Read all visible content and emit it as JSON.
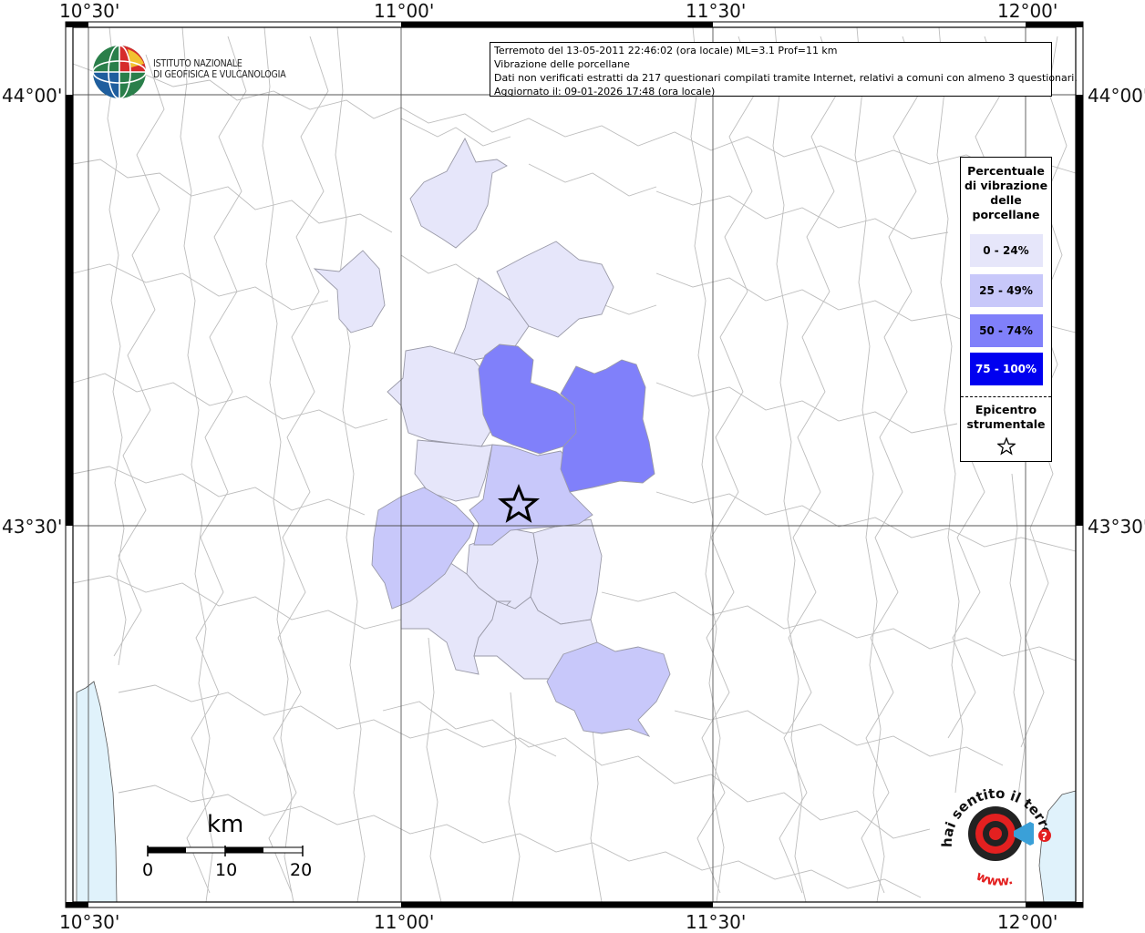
{
  "info": {
    "line1": "Terremoto del 13-05-2011 22:46:02 (ora locale) ML=3.1 Prof=11 km",
    "line2": "Vibrazione delle porcellane",
    "line3": "Dati non verificati estratti da 217 questionari compilati tramite Internet, relativi a comuni con almeno 3 questionari.",
    "line4": "Aggiornato il: 09-01-2026 17:48 (ora locale)"
  },
  "logo": {
    "line1": "ISTITUTO NAZIONALE",
    "line2": "DI GEOFISICA E VULCANOLOGIA"
  },
  "coords": {
    "top": [
      "10°30'",
      "11°00'",
      "11°30'",
      "12°00'"
    ],
    "bottom": [
      "10°30'",
      "11°00'",
      "11°30'",
      "12°00'"
    ],
    "left": [
      "44°00'",
      "43°30'"
    ],
    "right": [
      "44°00'",
      "43°30'"
    ]
  },
  "legend": {
    "title_lines": [
      "Percentuale",
      "di vibrazione",
      "delle",
      "porcellane"
    ],
    "classes": [
      {
        "label": "0 - 24%",
        "color": "#e6e6fa",
        "text_color": "#000000"
      },
      {
        "label": "25 - 49%",
        "color": "#c8c8fa",
        "text_color": "#000000"
      },
      {
        "label": "50 - 74%",
        "color": "#8080fa",
        "text_color": "#000000"
      },
      {
        "label": "75 - 100%",
        "color": "#0000f0",
        "text_color": "#ffffff"
      }
    ],
    "epicenter_lines": [
      "Epicentro",
      "strumentale"
    ]
  },
  "scale": {
    "unit": "km",
    "ticks": [
      "0",
      "10",
      "20"
    ]
  },
  "watermark": {
    "top_text": "hai sentito il terremoto.it",
    "bottom_text": "www.",
    "mark": "?"
  }
}
